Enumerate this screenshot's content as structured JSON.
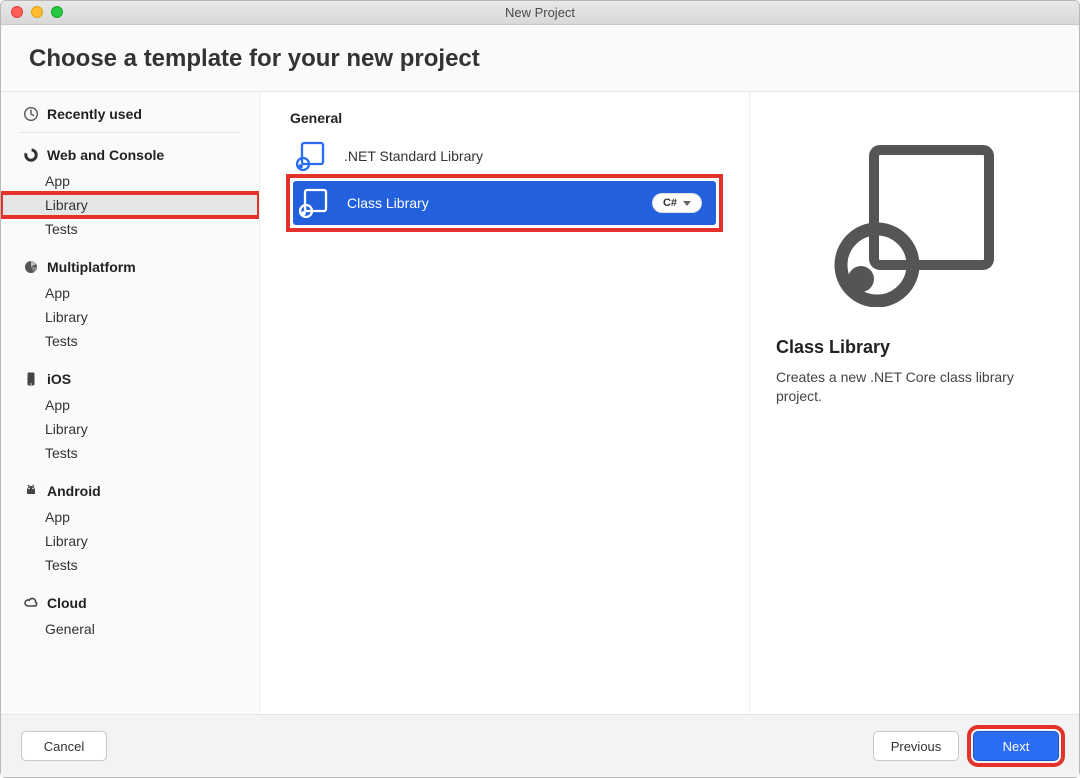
{
  "window": {
    "title": "New Project"
  },
  "header": {
    "title": "Choose a template for your new project"
  },
  "sidebar": {
    "recently_used": {
      "label": "Recently used"
    },
    "sections": [
      {
        "id": "web-console",
        "label": "Web and Console",
        "icon": "ring-icon",
        "items": [
          {
            "id": "wc-app",
            "label": "App"
          },
          {
            "id": "wc-library",
            "label": "Library",
            "selected": true
          },
          {
            "id": "wc-tests",
            "label": "Tests"
          }
        ]
      },
      {
        "id": "multiplatform",
        "label": "Multiplatform",
        "icon": "pie-icon",
        "items": [
          {
            "id": "mp-app",
            "label": "App"
          },
          {
            "id": "mp-library",
            "label": "Library"
          },
          {
            "id": "mp-tests",
            "label": "Tests"
          }
        ]
      },
      {
        "id": "ios",
        "label": "iOS",
        "icon": "phone-icon",
        "items": [
          {
            "id": "ios-app",
            "label": "App"
          },
          {
            "id": "ios-library",
            "label": "Library"
          },
          {
            "id": "ios-tests",
            "label": "Tests"
          }
        ]
      },
      {
        "id": "android",
        "label": "Android",
        "icon": "android-icon",
        "items": [
          {
            "id": "and-app",
            "label": "App"
          },
          {
            "id": "and-library",
            "label": "Library"
          },
          {
            "id": "and-tests",
            "label": "Tests"
          }
        ]
      },
      {
        "id": "cloud",
        "label": "Cloud",
        "icon": "cloud-icon",
        "items": [
          {
            "id": "cl-general",
            "label": "General"
          }
        ]
      }
    ]
  },
  "center": {
    "section_title": "General",
    "templates": [
      {
        "id": "net-std-lib",
        "label": ".NET Standard Library",
        "selected": false
      },
      {
        "id": "class-lib",
        "label": "Class Library",
        "selected": true,
        "language": "C#"
      }
    ]
  },
  "detail": {
    "title": "Class Library",
    "description": "Creates a new .NET Core class library project."
  },
  "footer": {
    "cancel": "Cancel",
    "previous": "Previous",
    "next": "Next"
  }
}
